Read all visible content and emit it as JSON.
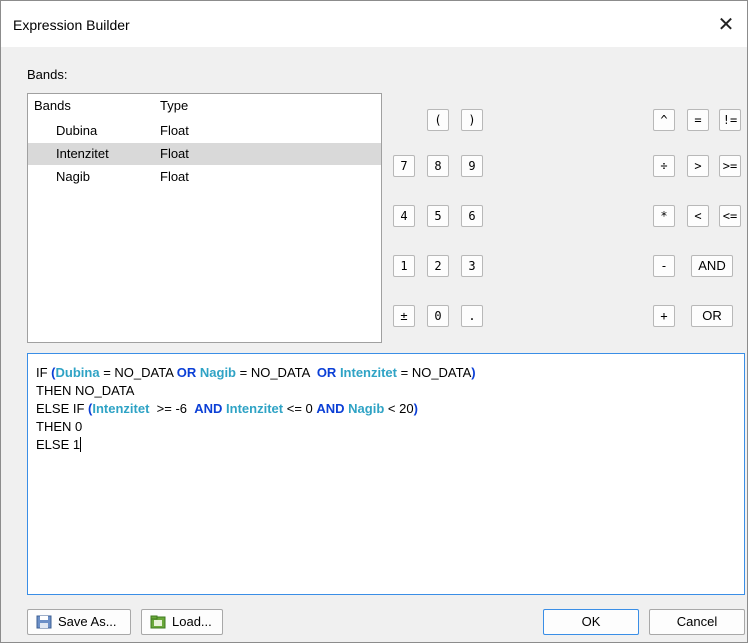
{
  "window": {
    "title": "Expression Builder",
    "close_icon": "close-icon"
  },
  "bands": {
    "label": "Bands:",
    "columns": [
      "Bands",
      "Type"
    ],
    "rows": [
      {
        "name": "Dubina",
        "type": "Float",
        "selected": false
      },
      {
        "name": "Intenzitet",
        "type": "Float",
        "selected": true
      },
      {
        "name": "Nagib",
        "type": "Float",
        "selected": false
      }
    ]
  },
  "keypad": {
    "parens": [
      "(",
      ")"
    ],
    "numbers": [
      [
        "7",
        "8",
        "9"
      ],
      [
        "4",
        "5",
        "6"
      ],
      [
        "1",
        "2",
        "3"
      ],
      [
        "±",
        "0",
        "."
      ]
    ],
    "ops_col1": [
      "^",
      "÷",
      "*",
      "-",
      "+"
    ],
    "ops_col2": [
      "=",
      ">",
      "<"
    ],
    "ops_col3": [
      "!=",
      ">=",
      "<="
    ],
    "logic": [
      "AND",
      "OR"
    ]
  },
  "expression": {
    "lines": [
      [
        [
          "t",
          "IF "
        ],
        [
          "k",
          "("
        ],
        [
          "f",
          "Dubina"
        ],
        [
          "t",
          " = NO_DATA "
        ],
        [
          "k",
          "OR"
        ],
        [
          "t",
          " "
        ],
        [
          "f",
          "Nagib"
        ],
        [
          "t",
          " = NO_DATA  "
        ],
        [
          "k",
          "OR"
        ],
        [
          "t",
          " "
        ],
        [
          "f",
          "Intenzitet"
        ],
        [
          "t",
          " = NO_DATA"
        ],
        [
          "k",
          ")"
        ]
      ],
      [
        [
          "t",
          "THEN NO_DATA"
        ]
      ],
      [
        [
          "t",
          "ELSE IF "
        ],
        [
          "k",
          "("
        ],
        [
          "f",
          "Intenzitet"
        ],
        [
          "t",
          "  >= -6  "
        ],
        [
          "k",
          "AND"
        ],
        [
          "t",
          " "
        ],
        [
          "f",
          "Intenzitet"
        ],
        [
          "t",
          " <= 0 "
        ],
        [
          "k",
          "AND"
        ],
        [
          "t",
          " "
        ],
        [
          "f",
          "Nagib"
        ],
        [
          "t",
          " < 20"
        ],
        [
          "k",
          ")"
        ]
      ],
      [
        [
          "t",
          "THEN 0"
        ]
      ],
      [
        [
          "t",
          "ELSE 1"
        ]
      ]
    ]
  },
  "footer": {
    "save_as": "Save As...",
    "load": "Load...",
    "ok": "OK",
    "cancel": "Cancel"
  },
  "colors": {
    "keyword": "#0b3fd6",
    "field": "#2fa3c5",
    "focus": "#3a8ee6"
  }
}
